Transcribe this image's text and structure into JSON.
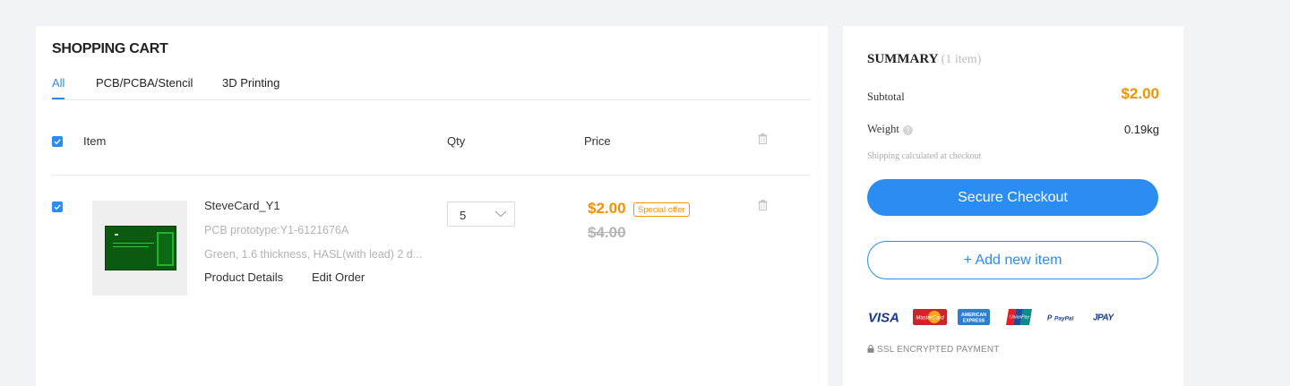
{
  "cart": {
    "title": "SHOPPING CART",
    "tabs": [
      {
        "label": "All",
        "active": true
      },
      {
        "label": "PCB/PCBA/Stencil",
        "active": false
      },
      {
        "label": "3D Printing",
        "active": false
      }
    ],
    "columns": {
      "item": "Item",
      "qty": "Qty",
      "price": "Price"
    },
    "select_all_checked": true,
    "items": [
      {
        "checked": true,
        "name": "SteveCard_Y1",
        "subtitle": "PCB prototype:Y1-6121676A",
        "specs": "Green, 1.6 thickness, HASL(with lead) 2 d...",
        "links": {
          "details": "Product Details",
          "edit": "Edit Order"
        },
        "qty": "5",
        "price": "$2.00",
        "badge": "Special offer",
        "original_price": "$4.00"
      }
    ]
  },
  "summary": {
    "title": "SUMMARY",
    "count": "(1 item)",
    "subtotal_label": "Subtotal",
    "subtotal": "$2.00",
    "weight_label": "Weight",
    "weight": "0.19kg",
    "shipping_note": "Shipping calculated at checkout",
    "checkout_label": "Secure Checkout",
    "add_item_label": "+  Add new item",
    "payment_methods": [
      "VISA",
      "MasterCard",
      "AMERICAN EXPRESS",
      "UnionPay",
      "PayPal",
      "JCB"
    ],
    "ssl_text": "SSL ENCRYPTED PAYMENT"
  },
  "colors": {
    "accent": "#2b8cf2",
    "price": "#f39200",
    "background": "#f2f3f7"
  }
}
